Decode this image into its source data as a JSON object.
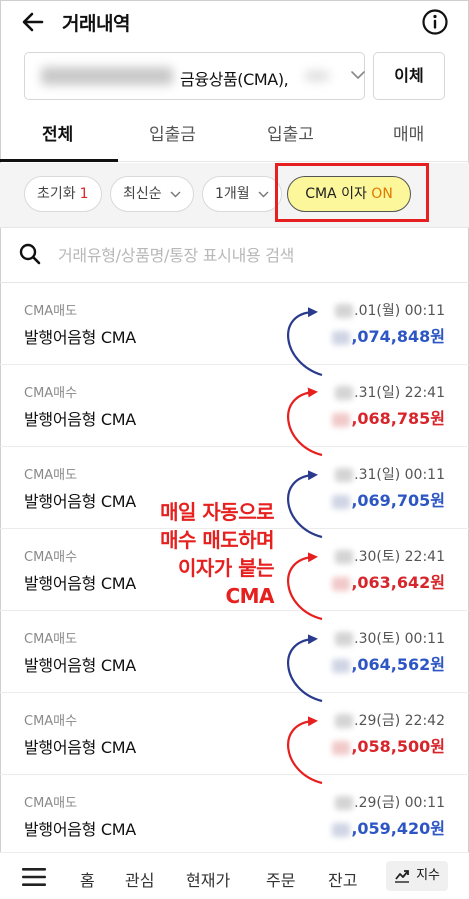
{
  "header": {
    "title": "거래내역",
    "back_icon": "arrow-left-icon",
    "info_icon": "info-circle-icon"
  },
  "account": {
    "product_label": "금융상품(CMA),",
    "transfer_label": "이체"
  },
  "tabs": [
    {
      "label": "전체",
      "active": true
    },
    {
      "label": "입출금",
      "active": false
    },
    {
      "label": "입출고",
      "active": false
    },
    {
      "label": "매매",
      "active": false
    }
  ],
  "filters": {
    "reset_label": "초기화",
    "reset_count": "1",
    "sort_label": "최신순",
    "period_label": "1개월",
    "cma_interest_label": "CMA 이자",
    "cma_interest_state": "ON"
  },
  "search": {
    "placeholder": "거래유형/상품명/통장 표시내용 검색"
  },
  "transactions": [
    {
      "type": "CMA매도",
      "name": "발행어음형 CMA",
      "date": ".01(월) 00:11",
      "amount": ",074,848원",
      "kind": "sell"
    },
    {
      "type": "CMA매수",
      "name": "발행어음형 CMA",
      "date": ".31(일) 22:41",
      "amount": ",068,785원",
      "kind": "buy"
    },
    {
      "type": "CMA매도",
      "name": "발행어음형 CMA",
      "date": ".31(일) 00:11",
      "amount": ",069,705원",
      "kind": "sell"
    },
    {
      "type": "CMA매수",
      "name": "발행어음형 CMA",
      "date": ".30(토) 22:41",
      "amount": ",063,642원",
      "kind": "buy"
    },
    {
      "type": "CMA매도",
      "name": "발행어음형 CMA",
      "date": ".30(토) 00:11",
      "amount": ",064,562원",
      "kind": "sell"
    },
    {
      "type": "CMA매수",
      "name": "발행어음형 CMA",
      "date": ".29(금) 22:42",
      "amount": ",058,500원",
      "kind": "buy"
    },
    {
      "type": "CMA매도",
      "name": "발행어음형 CMA",
      "date": ".29(금) 00:11",
      "amount": ",059,420원",
      "kind": "sell"
    }
  ],
  "annotation": {
    "line1": "매일 자동으로",
    "line2": "매수 매도하며",
    "line3": "이자가 붙는",
    "line4": "CMA"
  },
  "bottom_nav": {
    "menu_icon": "hamburger-menu-icon",
    "items": [
      "홈",
      "관심",
      "현재가",
      "주문",
      "잔고"
    ],
    "index_label": "지수",
    "index_icon": "trend-chart-icon"
  },
  "colors": {
    "sell": "#2d56c4",
    "buy": "#d7262b",
    "highlight_border": "#e6201e",
    "highlight_chip": "#fbf79a",
    "on_text": "#e07a00"
  }
}
